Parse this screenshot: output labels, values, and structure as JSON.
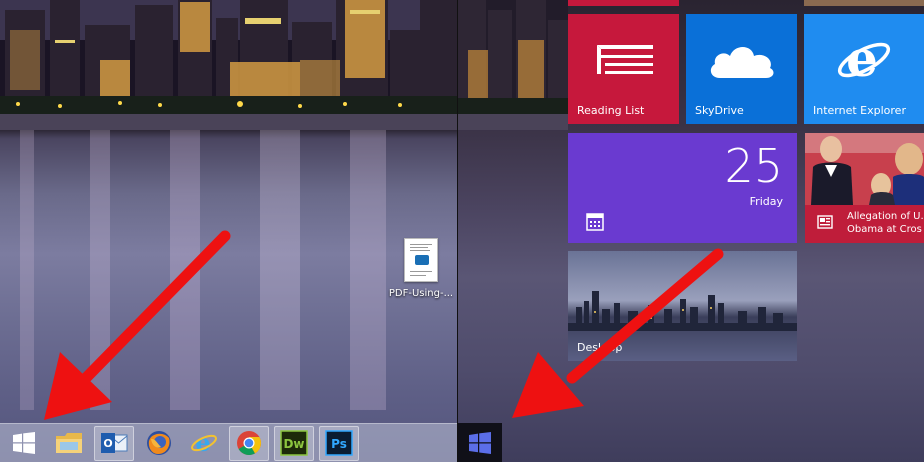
{
  "desktop": {
    "icon_label": "PDF-Using-...",
    "taskbar": {
      "items": [
        {
          "name": "start-button",
          "icon": "windows-logo-icon"
        },
        {
          "name": "file-explorer",
          "icon": "folder-icon"
        },
        {
          "name": "outlook",
          "icon": "outlook-icon"
        },
        {
          "name": "firefox",
          "icon": "firefox-icon"
        },
        {
          "name": "internet-explorer",
          "icon": "ie-icon"
        },
        {
          "name": "chrome",
          "icon": "chrome-icon"
        },
        {
          "name": "dreamweaver",
          "icon": "dreamweaver-icon",
          "text": "Dw"
        },
        {
          "name": "photoshop",
          "icon": "photoshop-icon",
          "text": "Ps"
        }
      ]
    }
  },
  "start_screen": {
    "tiles": {
      "reading_list": {
        "label": "Reading List",
        "color": "#c6183c"
      },
      "skydrive": {
        "label": "SkyDrive",
        "color": "#0a70d8"
      },
      "internet_explorer": {
        "label": "Internet Explorer",
        "color": "#1f8cf0"
      },
      "calendar": {
        "day": "25",
        "weekday": "Friday",
        "color": "#6a3ad0"
      },
      "news": {
        "line1": "Allegation of U.",
        "line2": "Obama at Cros",
        "color": "#bf1d3a"
      },
      "desktop": {
        "label": "Desktop"
      }
    }
  },
  "annotation": {
    "arrow_color": "#ee1111"
  }
}
